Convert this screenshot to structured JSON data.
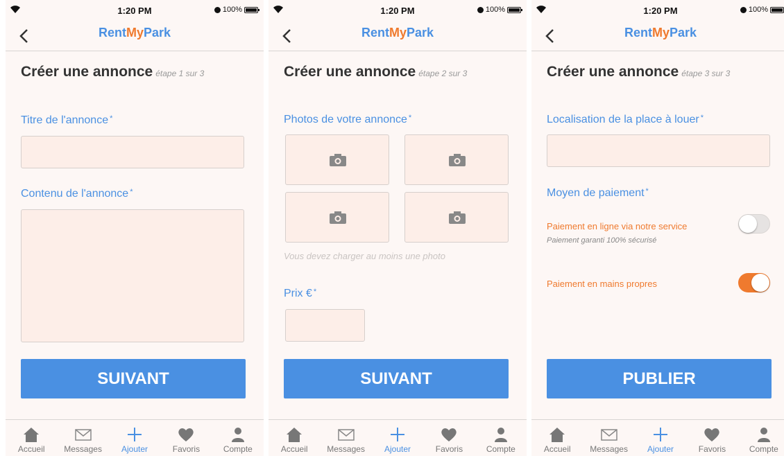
{
  "status": {
    "time": "1:20 PM",
    "battery": "100%"
  },
  "brand": {
    "part1": "Rent",
    "part2": "My",
    "part3": "Park"
  },
  "colors": {
    "blue": "#4a90e2",
    "orange": "#ef7a2e",
    "field": "#fdeee8"
  },
  "tabs": [
    "Accueil",
    "Messages",
    "Ajouter",
    "Favoris",
    "Compte"
  ],
  "tab_icons": [
    "home-icon",
    "envelope-icon",
    "plus-icon",
    "heart-icon",
    "user-icon"
  ],
  "active_tab": "Ajouter",
  "screen1": {
    "title": "Créer une annonce",
    "step": "étape 1 sur 3",
    "title_label": "Titre de l'annonce",
    "content_label": "Contenu de l'annonce",
    "required_mark": "*",
    "button": "SUIVANT"
  },
  "screen2": {
    "title": "Créer une annonce",
    "step": "étape 2 sur 3",
    "photos_label": "Photos de votre annonce",
    "photos_hint": "Vous devez charger au moins une photo",
    "price_label": "Prix €",
    "required_mark": "*",
    "button": "SUIVANT"
  },
  "screen3": {
    "title": "Créer une annonce",
    "step": "étape 3 sur 3",
    "location_label": "Localisation de la place à louer",
    "payment_label": "Moyen de paiement",
    "required_mark": "*",
    "online_payment": "Paiement en ligne via notre service",
    "online_payment_sub": "Paiement garanti 100% sécurisé",
    "online_payment_on": false,
    "hand_payment": "Paiement en mains propres",
    "hand_payment_on": true,
    "button": "PUBLIER"
  }
}
